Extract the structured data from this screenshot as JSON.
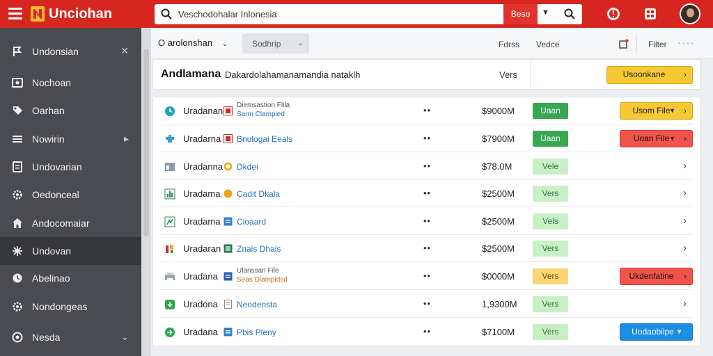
{
  "app": {
    "title": "Unciohan"
  },
  "search": {
    "value": "Veschodohalar Inlonesia",
    "button": "Beso"
  },
  "sidebar": {
    "items": [
      {
        "label": "Undonsian",
        "icon": "flag-icon",
        "right": "✕"
      },
      {
        "label": "Nochoan",
        "icon": "image-icon",
        "right": ""
      },
      {
        "label": "Oarhan",
        "icon": "tag-icon",
        "right": ""
      },
      {
        "label": "Nowirin",
        "icon": "list-icon",
        "right": "▸"
      },
      {
        "label": "Undovarian",
        "icon": "document-icon",
        "right": ""
      },
      {
        "label": "Oedonceal",
        "icon": "gear-icon",
        "right": ""
      },
      {
        "label": "Andocomaiar",
        "icon": "home-icon",
        "right": ""
      },
      {
        "label": "Undovan",
        "icon": "arrows-icon",
        "right": ""
      },
      {
        "label": "Abelinao",
        "icon": "chat-icon",
        "right": ""
      },
      {
        "label": "Nondongeas",
        "icon": "settings-icon",
        "right": ""
      },
      {
        "label": "Nesda",
        "icon": "info-icon",
        "right": "⌄"
      }
    ]
  },
  "toolbar": {
    "select1": "O arolonshan",
    "select2": "Sodhrip",
    "text1": "Fdrss",
    "text2": "Vedce",
    "filter": "Filter",
    "more": "- - - -"
  },
  "header": {
    "title": "Andlamana",
    "subtitle": "Dakardolahamanamandia nataklh",
    "vers": "Vers",
    "button": "Usoonkane"
  },
  "rows": [
    {
      "name": "Uradanan",
      "icon": "clock-icon",
      "file_icon": "pdf-icon",
      "file": "Diemsastion Flila",
      "file2": "Sarm Clampied",
      "dots": "••",
      "price": "$9000M",
      "status": "Uaan",
      "status_style": "dark",
      "action": "Usom File",
      "action_style": "yellow"
    },
    {
      "name": "Uradarna",
      "icon": "puzzle-icon",
      "file_icon": "pdf-icon",
      "file": "Bnulogai Eeals",
      "file2": "",
      "dots": "••",
      "price": "$7900M",
      "status": "Uaan",
      "status_style": "dark",
      "action": "Uoan File",
      "action_style": "red"
    },
    {
      "name": "Uradanna",
      "icon": "table-icon",
      "file_icon": "coin-icon",
      "file": "Dkdei",
      "file2": "",
      "dots": "••",
      "price": "$78.0M",
      "status": "Vele",
      "status_style": "light",
      "action": "",
      "action_style": ""
    },
    {
      "name": "Uradama",
      "icon": "chart-icon",
      "file_icon": "circle-icon",
      "file": "Cadit Dkala",
      "file2": "",
      "dots": "••",
      "price": "$2500M",
      "status": "Vers",
      "status_style": "light",
      "action": "",
      "action_style": ""
    },
    {
      "name": "Uradama",
      "icon": "sheet-icon",
      "file_icon": "doc-icon",
      "file": "Cioaard",
      "file2": "",
      "dots": "••",
      "price": "$2500M",
      "status": "Vels",
      "status_style": "light",
      "action": "",
      "action_style": ""
    },
    {
      "name": "Uradaran",
      "icon": "tools-icon",
      "file_icon": "sheet-icon",
      "file": "Znais Dhais",
      "file2": "",
      "dots": "••",
      "price": "$2500M",
      "status": "Vers",
      "status_style": "light",
      "action": "",
      "action_style": ""
    },
    {
      "name": "Uradana",
      "icon": "printer-icon",
      "file_icon": "doc-icon",
      "file": "Ulanssan File",
      "file2": "Seas Diampidsd",
      "dots": "••",
      "price": "$0000M",
      "status": "Vers",
      "status_style": "amber",
      "action": "Ukdenfatine",
      "action_style": "red"
    },
    {
      "name": "Uradona",
      "icon": "download-icon",
      "file_icon": "file-icon",
      "file": "Neodensta",
      "file2": "",
      "dots": "••",
      "price": "1,9300M",
      "status": "Vers",
      "status_style": "light",
      "action": "",
      "action_style": ""
    },
    {
      "name": "Uradana",
      "icon": "arrow-icon",
      "file_icon": "doc-icon",
      "file": "Pbis Pleny",
      "file2": "",
      "dots": "••",
      "price": "$7100M",
      "status": "Vers",
      "status_style": "light",
      "action": "Uodaobiipe",
      "action_style": "blue"
    }
  ],
  "colors": {
    "topbar": "#d7261f",
    "sidebar": "#4a4b50",
    "badge_dark": "#37a84f",
    "badge_light": "#c9efc6",
    "badge_amber": "#fbd674",
    "action_yellow": "#f6c934",
    "action_red": "#f0544a",
    "action_blue": "#1d8ee6"
  }
}
